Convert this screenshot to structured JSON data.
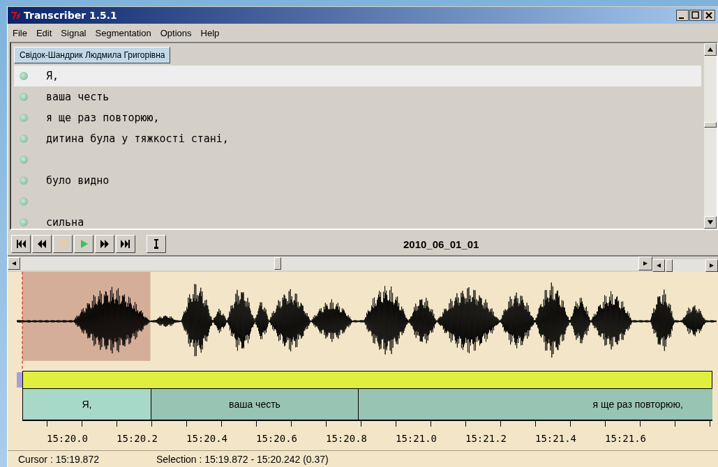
{
  "window": {
    "title": "Transcriber 1.5.1"
  },
  "menu": [
    "File",
    "Edit",
    "Signal",
    "Segmentation",
    "Options",
    "Help"
  ],
  "speaker_button": "Свідок-Шандрик Людмила Григорівна",
  "transcript": [
    {
      "text": "Я,",
      "selected": true
    },
    {
      "text": "ваша честь",
      "selected": false
    },
    {
      "text": "я ще раз повторюю,",
      "selected": false
    },
    {
      "text": "дитина була у тяжкості стані,",
      "selected": false
    },
    {
      "selected": false
    },
    {
      "text": "було видно",
      "selected": false
    },
    {
      "selected": false
    },
    {
      "text": "сильна",
      "selected": false
    }
  ],
  "toolbar": {
    "buttons": [
      {
        "kind": "first"
      },
      {
        "kind": "rewind"
      },
      {
        "kind": "pause",
        "disabled": true
      },
      {
        "kind": "play",
        "disabled": false
      },
      {
        "kind": "forward"
      },
      {
        "kind": "last"
      },
      {
        "kind": "info"
      }
    ],
    "file_name": "2010_06_01_01"
  },
  "segments": [
    {
      "text": "Я,",
      "selected": true
    },
    {
      "text": "ваша честь",
      "selected": false
    },
    {
      "text": "я ще раз повторюю,",
      "selected": false
    }
  ],
  "time_ticks": [
    "15:20.0",
    "15:20.2",
    "15:20.4",
    "15:20.6",
    "15:20.8",
    "15:21.0",
    "15:21.2",
    "15:21.4",
    "15:21.6"
  ],
  "status_bar": {
    "cursor": "Cursor : 15:19.872",
    "selection": "Selection : 15:19.872 - 15:20.242 (0.37)"
  }
}
